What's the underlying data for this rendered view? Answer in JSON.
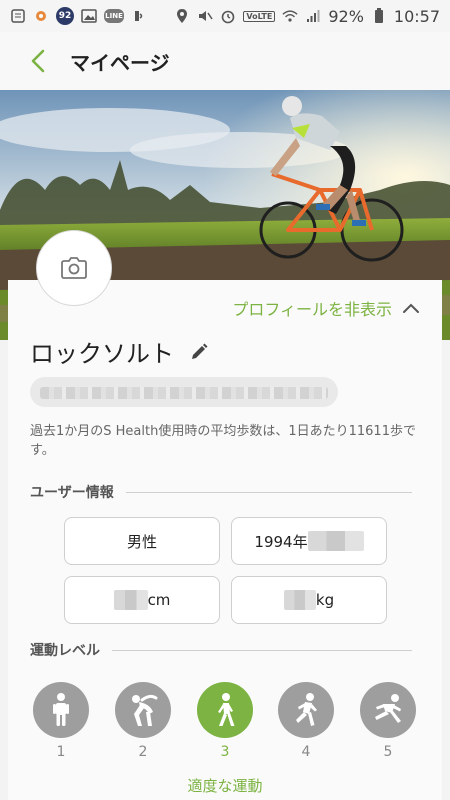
{
  "status_bar": {
    "notification_badge": "92",
    "line_badge": "LINE",
    "volte": "VoLTE",
    "battery": "92%",
    "time": "10:57"
  },
  "app_bar": {
    "title": "マイページ"
  },
  "profile": {
    "hide_profile_label": "プロフィールを非表示",
    "username": "ロックソルト",
    "stats_text": "過去1か月のS Health使用時の平均歩数は、1日あたり11611歩です。"
  },
  "user_info": {
    "section_title": "ユーザー情報",
    "gender": "男性",
    "birth_prefix": "1994年",
    "height_unit": "cm",
    "weight_unit": "kg"
  },
  "activity": {
    "section_title": "運動レベル",
    "levels": [
      "1",
      "2",
      "3",
      "4",
      "5"
    ],
    "selected_level": 3,
    "selected_description": "適度な運動"
  },
  "colors": {
    "accent": "#7cb342",
    "inactive": "#9e9e9e"
  }
}
